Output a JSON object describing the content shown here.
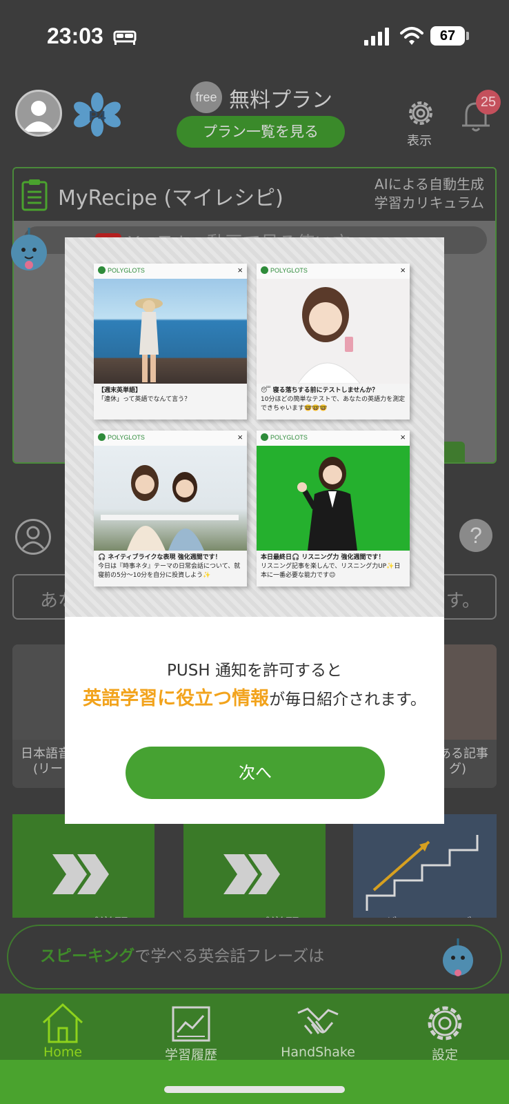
{
  "status_bar": {
    "time": "23:03",
    "battery": "67",
    "battery_level_percent": 67,
    "icons": [
      "sleep-icon",
      "signal-icon",
      "wifi-icon",
      "battery-icon"
    ]
  },
  "header": {
    "plan_badge": "free",
    "plan_name": "無料プラン",
    "plan_button": "プラン一覧を見る",
    "display_label": "表示",
    "notification_count": "25"
  },
  "recipe": {
    "title": "MyRecipe (マイレシピ)",
    "ai_line1": "AIによる自動生成",
    "ai_line2": "学習カリキュラム",
    "youtube_banner": "YouTube 動画で見る使い方"
  },
  "middle": {
    "help": "?",
    "search_left": "あな",
    "search_right": "す。"
  },
  "articles": {
    "left_line1": "日本語音",
    "left_line2": "(リー",
    "right_line1": "ある記事",
    "right_line2": "グ)"
  },
  "step_cards": {
    "label": "ステップ学習",
    "ladder_label": "ラダーシリーズ"
  },
  "speaking": {
    "highlight": "スピーキング",
    "rest": "で学べる英会話フレーズは"
  },
  "tabs": [
    {
      "label": "Home",
      "icon": "home-icon",
      "active": true
    },
    {
      "label": "学習履歴",
      "icon": "chart-icon",
      "active": false
    },
    {
      "label": "HandShake",
      "icon": "handshake-icon",
      "active": false
    },
    {
      "label": "設定",
      "icon": "gear-icon",
      "active": false
    }
  ],
  "modal": {
    "cards": [
      {
        "brand": "POLYGLOTS",
        "close": "×",
        "title": "【週末英単語】",
        "body": "「連休」って英語でなんて言う？"
      },
      {
        "brand": "POLYGLOTS",
        "close": "×",
        "title": "😴 寝る落ちする前にテストしませんか？",
        "body": "10分ほどの簡単なテストで、あなたの英語力を測定できちゃいます🤓🤓🤓"
      },
      {
        "brand": "POLYGLOTS",
        "close": "×",
        "title": "🎧 ネイティブライクな表現 強化週間です！",
        "body": "今日は『時事ネタ』テーマの日常会話について、就寝前の5分〜10分を自分に投資しよう✨"
      },
      {
        "brand": "POLYGLOTS",
        "close": "×",
        "title": "本日最終日🎧 リスニング力 強化週間です！",
        "body": "リスニング記事を楽しんで、リスニング力UP✨日本に一番必要な能力です😉"
      }
    ],
    "message_line1": "PUSH 通知を許可すると",
    "message_highlight": "英語学習に役立つ情報",
    "message_rest": "が毎日紹介されます。",
    "next_button": "次へ"
  },
  "colors": {
    "accent_green": "#46a232",
    "highlight_orange": "#f2a31c",
    "badge_red": "#c4505c",
    "tab_active": "#8ed21c"
  }
}
